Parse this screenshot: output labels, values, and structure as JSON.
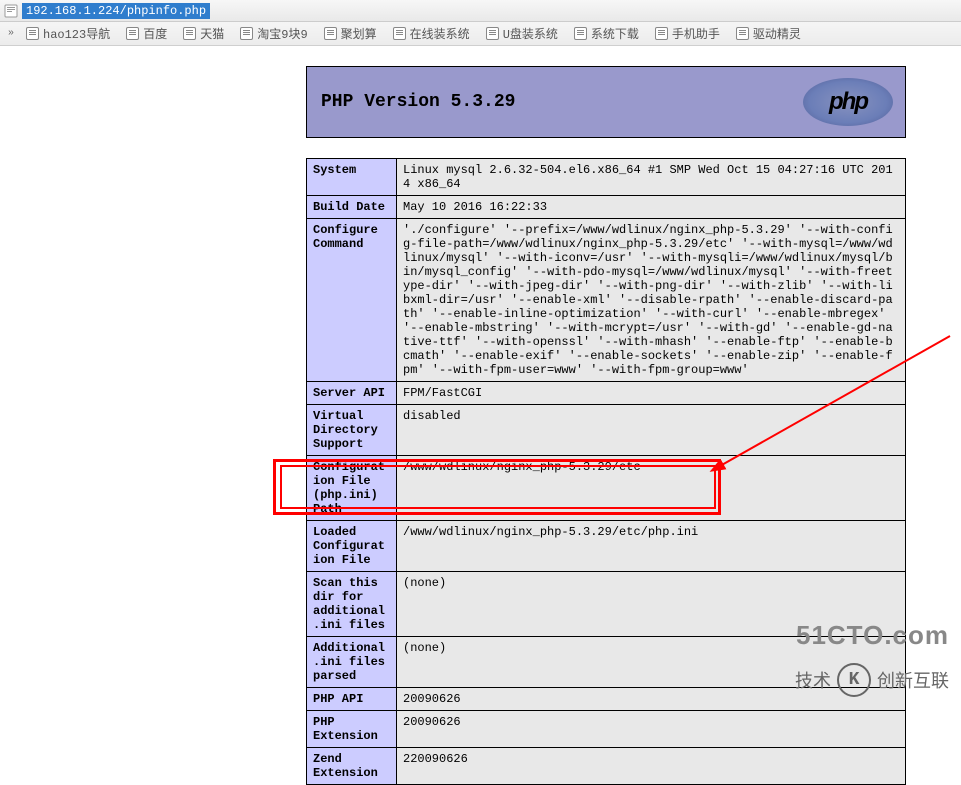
{
  "address_bar": {
    "url": "192.168.1.224/phpinfo.php"
  },
  "bookmarks": [
    {
      "label": "hao123导航"
    },
    {
      "label": "百度"
    },
    {
      "label": "天猫"
    },
    {
      "label": "淘宝9块9"
    },
    {
      "label": "聚划算"
    },
    {
      "label": "在线装系统"
    },
    {
      "label": "U盘装系统"
    },
    {
      "label": "系统下载"
    },
    {
      "label": "手机助手"
    },
    {
      "label": "驱动精灵"
    }
  ],
  "phpinfo": {
    "title": "PHP Version 5.3.29",
    "logo_text": "php",
    "rows": [
      {
        "key": "System",
        "value": "Linux mysql 2.6.32-504.el6.x86_64 #1 SMP Wed Oct 15 04:27:16 UTC 2014 x86_64"
      },
      {
        "key": "Build Date",
        "value": "May 10 2016 16:22:33"
      },
      {
        "key": "Configure Command",
        "value": "'./configure' '--prefix=/www/wdlinux/nginx_php-5.3.29' '--with-config-file-path=/www/wdlinux/nginx_php-5.3.29/etc' '--with-mysql=/www/wdlinux/mysql' '--with-iconv=/usr' '--with-mysqli=/www/wdlinux/mysql/bin/mysql_config' '--with-pdo-mysql=/www/wdlinux/mysql' '--with-freetype-dir' '--with-jpeg-dir' '--with-png-dir' '--with-zlib' '--with-libxml-dir=/usr' '--enable-xml' '--disable-rpath' '--enable-discard-path' '--enable-inline-optimization' '--with-curl' '--enable-mbregex' '--enable-mbstring' '--with-mcrypt=/usr' '--with-gd' '--enable-gd-native-ttf' '--with-openssl' '--with-mhash' '--enable-ftp' '--enable-bcmath' '--enable-exif' '--enable-sockets' '--enable-zip' '--enable-fpm' '--with-fpm-user=www' '--with-fpm-group=www'"
      },
      {
        "key": "Server API",
        "value": "FPM/FastCGI"
      },
      {
        "key": "Virtual Directory Support",
        "value": "disabled"
      },
      {
        "key": "Configuration File (php.ini) Path",
        "value": "/www/wdlinux/nginx_php-5.3.29/etc"
      },
      {
        "key": "Loaded Configuration File",
        "value": "/www/wdlinux/nginx_php-5.3.29/etc/php.ini",
        "highlight": true
      },
      {
        "key": "Scan this dir for additional .ini files",
        "value": "(none)"
      },
      {
        "key": "Additional .ini files parsed",
        "value": "(none)"
      },
      {
        "key": "PHP API",
        "value": "20090626"
      },
      {
        "key": "PHP Extension",
        "value": "20090626"
      },
      {
        "key": "Zend Extension",
        "value": "220090626"
      }
    ]
  },
  "watermarks": {
    "w1": "51CTO.com",
    "w2_left": "技术",
    "w2_badge": "K",
    "w2_right": "创新互联"
  }
}
